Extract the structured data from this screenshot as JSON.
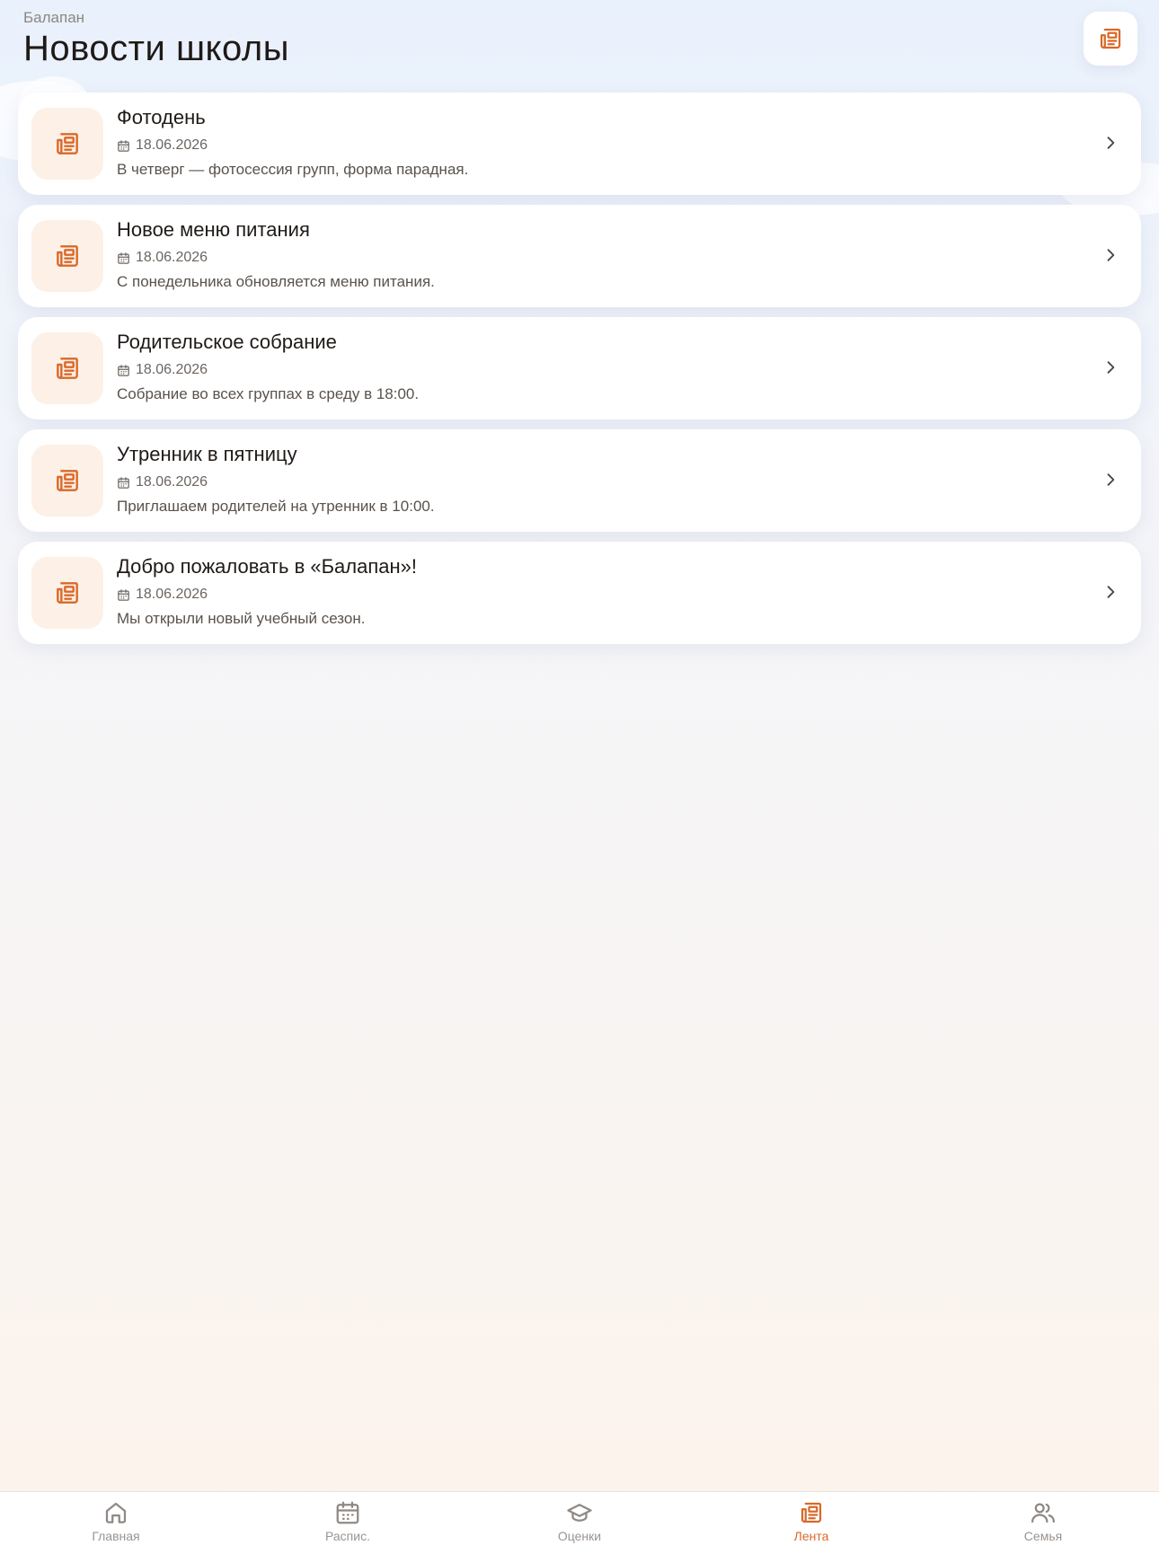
{
  "header": {
    "app_name": "Балапан",
    "title": "Новости школы",
    "action_icon": "newspaper-icon"
  },
  "colors": {
    "accent": "#d9692a",
    "icon_bg": "#fdf0e6",
    "tab_inactive": "#9a9490"
  },
  "news": [
    {
      "title": "Фотодень",
      "date": "18.06.2026",
      "text": "В четверг — фотосессия групп, форма парадная."
    },
    {
      "title": "Новое меню питания",
      "date": "18.06.2026",
      "text": "С понедельника обновляется меню питания."
    },
    {
      "title": "Родительское собрание",
      "date": "18.06.2026",
      "text": "Собрание во всех группах в среду в 18:00."
    },
    {
      "title": "Утренник в пятницу",
      "date": "18.06.2026",
      "text": "Приглашаем родителей на утренник в 10:00."
    },
    {
      "title": "Добро пожаловать в «Балапан»!",
      "date": "18.06.2026",
      "text": "Мы открыли новый учебный сезон."
    }
  ],
  "tabs": [
    {
      "label": "Главная",
      "icon": "home-icon",
      "active": false
    },
    {
      "label": "Распис.",
      "icon": "calendar-icon",
      "active": false
    },
    {
      "label": "Оценки",
      "icon": "graduation-cap-icon",
      "active": false
    },
    {
      "label": "Лента",
      "icon": "newspaper-icon",
      "active": true
    },
    {
      "label": "Семья",
      "icon": "users-icon",
      "active": false
    }
  ]
}
